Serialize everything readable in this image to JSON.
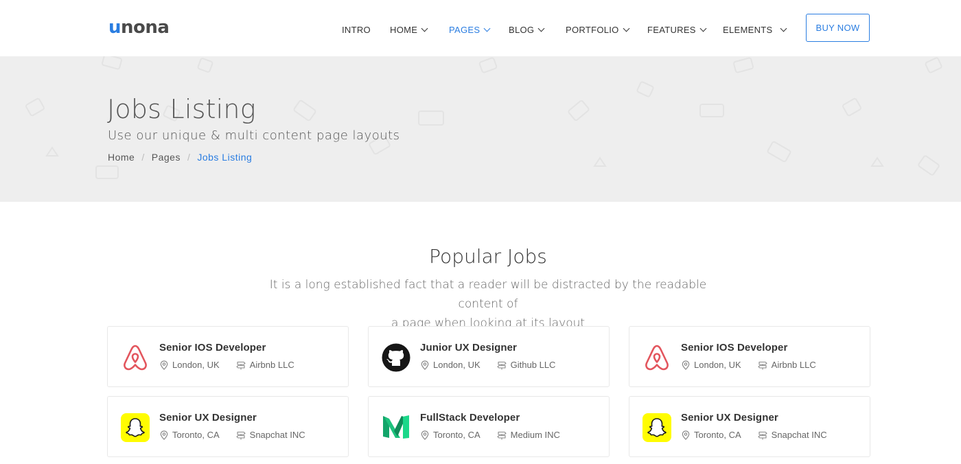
{
  "brand": {
    "logo_accent": "u",
    "logo_rest": "nona",
    "accent_color": "#2a7de1"
  },
  "nav": {
    "items": [
      {
        "label": "INTRO",
        "dropdown": false,
        "active": false
      },
      {
        "label": "HOME",
        "dropdown": true,
        "active": false
      },
      {
        "label": "PAGES",
        "dropdown": true,
        "active": true
      },
      {
        "label": "BLOG",
        "dropdown": true,
        "active": false
      },
      {
        "label": "PORTFOLIO",
        "dropdown": true,
        "active": false
      },
      {
        "label": "FEATURES",
        "dropdown": true,
        "active": false
      },
      {
        "label": "ELEMENTS",
        "dropdown": true,
        "active": false
      }
    ],
    "buy_label": "BUY NOW"
  },
  "hero": {
    "title": "Jobs Listing",
    "subtitle": "Use our unique & multi content page layouts",
    "breadcrumb": [
      "Home",
      "Pages",
      "Jobs Listing"
    ]
  },
  "section": {
    "title": "Popular Jobs",
    "description_line1": "It is a long established fact that a reader will be distracted by the readable content of",
    "description_line2": "a page when looking at its layout"
  },
  "jobs": [
    {
      "title": "Senior IOS Developer",
      "location": "London, UK",
      "company": "Airbnb LLC",
      "logo": "airbnb-logo-icon"
    },
    {
      "title": "Junior UX Designer",
      "location": "London, UK",
      "company": "Github LLC",
      "logo": "github-logo-icon"
    },
    {
      "title": "Senior IOS Developer",
      "location": "London, UK",
      "company": "Airbnb LLC",
      "logo": "airbnb-logo-icon"
    },
    {
      "title": "Senior UX Designer",
      "location": "Toronto, CA",
      "company": "Snapchat INC",
      "logo": "snapchat-logo-icon"
    },
    {
      "title": "FullStack Developer",
      "location": "Toronto, CA",
      "company": "Medium INC",
      "logo": "medium-logo-icon"
    },
    {
      "title": "Senior UX Designer",
      "location": "Toronto, CA",
      "company": "Snapchat INC",
      "logo": "snapchat-logo-icon"
    }
  ]
}
